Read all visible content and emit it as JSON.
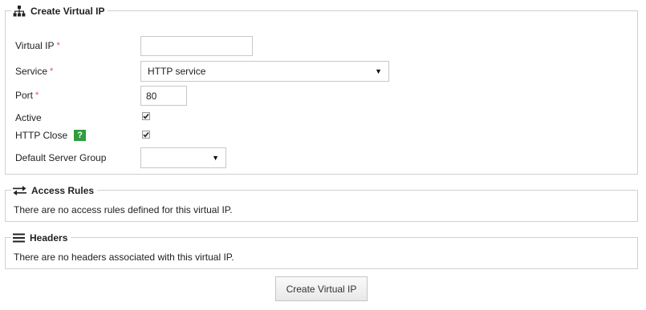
{
  "create_panel": {
    "title": "Create Virtual IP",
    "icon": "sitemap-icon",
    "fields": {
      "virtual_ip": {
        "label": "Virtual IP",
        "required_mark": "*",
        "value": ""
      },
      "service": {
        "label": "Service",
        "required_mark": "*",
        "value": "HTTP service"
      },
      "port": {
        "label": "Port",
        "required_mark": "*",
        "value": "80"
      },
      "active": {
        "label": "Active",
        "checked": true
      },
      "http_close": {
        "label": "HTTP Close",
        "checked": true,
        "help_icon": "?"
      },
      "default_server_group": {
        "label": "Default Server Group",
        "value": ""
      }
    }
  },
  "access_rules_panel": {
    "title": "Access Rules",
    "icon": "exchange-arrows-icon",
    "empty_message": "There are no access rules defined for this virtual IP."
  },
  "headers_panel": {
    "title": "Headers",
    "icon": "hamburger-lines-icon",
    "empty_message": "There are no headers associated with this virtual IP."
  },
  "submit_button": {
    "label": "Create Virtual IP"
  },
  "colors": {
    "required": "#d9534f",
    "help_badge": "#2e9e3e",
    "border": "#d0d0d0"
  }
}
